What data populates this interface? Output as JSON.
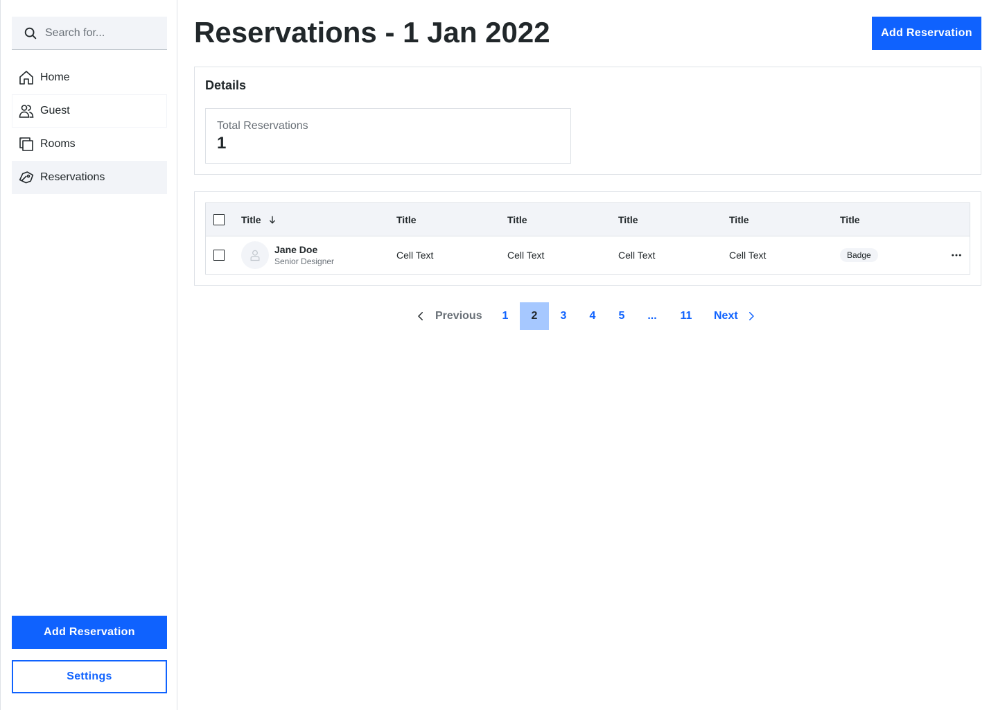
{
  "sidebar": {
    "search_placeholder": "Search for...",
    "items": [
      {
        "label": "Home",
        "icon": "home-icon"
      },
      {
        "label": "Guest",
        "icon": "users-icon"
      },
      {
        "label": "Rooms",
        "icon": "rooms-icon"
      },
      {
        "label": "Reservations",
        "icon": "tag-icon",
        "active": true
      }
    ],
    "primary_button": "Add Reservation",
    "secondary_button": "Settings"
  },
  "header": {
    "title": "Reservations - 1 Jan 2022",
    "action_button": "Add Reservation"
  },
  "details": {
    "heading": "Details",
    "stat_label": "Total Reservations",
    "stat_value": "1"
  },
  "table": {
    "columns": [
      "Title",
      "Title",
      "Title",
      "Title",
      "Title",
      "Title"
    ],
    "rows": [
      {
        "name": "Jane Doe",
        "role": "Senior Designer",
        "cells": [
          "Cell Text",
          "Cell Text",
          "Cell Text",
          "Cell Text"
        ],
        "badge": "Badge"
      }
    ]
  },
  "pagination": {
    "previous": "Previous",
    "next": "Next",
    "pages": [
      "1",
      "2",
      "3",
      "4",
      "5",
      "...",
      "11"
    ],
    "current": "2"
  },
  "colors": {
    "primary": "#0f62fe",
    "current_page_bg": "#a6c8ff",
    "surface": "#f2f4f8",
    "border": "#dde1e6",
    "text": "#21272a",
    "muted": "#697077"
  }
}
